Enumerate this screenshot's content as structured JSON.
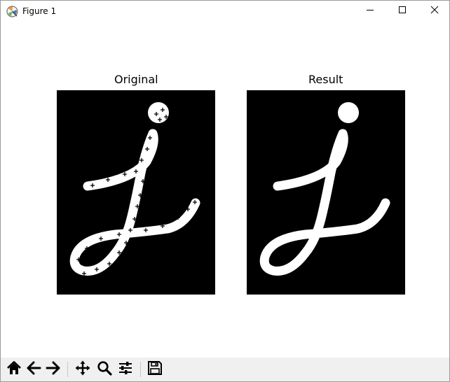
{
  "window": {
    "title": "Figure 1",
    "icons": {
      "app": "matplotlib-icon",
      "minimize": "minimize-icon",
      "maximize": "maximize-icon",
      "close": "close-icon"
    }
  },
  "figure": {
    "subplots": [
      {
        "title": "Original",
        "image": "binary-cursive-letter-j-with-plus-markers"
      },
      {
        "title": "Result",
        "image": "binary-cursive-letter-j"
      }
    ]
  },
  "toolbar": {
    "buttons": [
      {
        "icon": "home-icon"
      },
      {
        "icon": "back-arrow-icon"
      },
      {
        "icon": "forward-arrow-icon"
      },
      {
        "icon": "pan-move-icon"
      },
      {
        "icon": "zoom-magnifier-icon"
      },
      {
        "icon": "subplots-configure-icon"
      },
      {
        "icon": "save-floppy-icon"
      }
    ]
  }
}
